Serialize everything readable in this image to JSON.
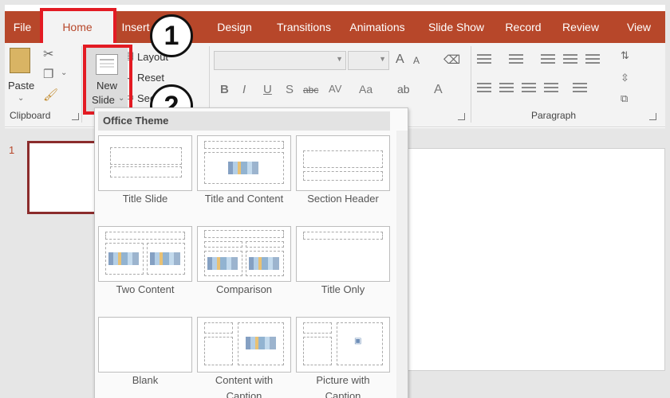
{
  "ribbon_tabs": [
    "File",
    "Home",
    "Insert",
    "Design",
    "Transitions",
    "Animations",
    "Slide Show",
    "Record",
    "Review",
    "View"
  ],
  "active_tab": "Home",
  "clipboard": {
    "paste_label": "Paste",
    "group_label": "Clipboard"
  },
  "slides_group": {
    "new_slide_line1": "New",
    "new_slide_line2": "Slide",
    "layout_label": "Layout",
    "reset_label": "Reset",
    "section_label": "Section"
  },
  "font_group": {
    "bold": "B",
    "italic": "I",
    "underline": "U",
    "strike": "S",
    "spacing": "AV",
    "change_case": "Aa",
    "font_color": "A",
    "grow_font": "A",
    "shrink_font": "A"
  },
  "paragraph": {
    "group_label": "Paragraph"
  },
  "steps": [
    "1",
    "2"
  ],
  "slide_pane": {
    "slide_number": "1"
  },
  "gallery": {
    "header": "Office Theme",
    "layouts": [
      {
        "name_line1": "Title Slide",
        "name_line2": ""
      },
      {
        "name_line1": "Title and Content",
        "name_line2": ""
      },
      {
        "name_line1": "Section Header",
        "name_line2": ""
      },
      {
        "name_line1": "Two Content",
        "name_line2": ""
      },
      {
        "name_line1": "Comparison",
        "name_line2": ""
      },
      {
        "name_line1": "Title Only",
        "name_line2": ""
      },
      {
        "name_line1": "Blank",
        "name_line2": ""
      },
      {
        "name_line1": "Content with",
        "name_line2": "Caption"
      },
      {
        "name_line1": "Picture with",
        "name_line2": "Caption"
      }
    ]
  },
  "colors": {
    "ribbon_accent": "#b7472a",
    "highlight_red": "#e31b23"
  },
  "icons": [
    "paste-icon",
    "cut-icon",
    "copy-icon",
    "format-painter-icon",
    "new-slide-icon",
    "layout-icon",
    "reset-icon",
    "section-icon",
    "dialog-launcher-icon",
    "bullets-icon",
    "numbering-icon",
    "align-left-icon",
    "align-center-icon",
    "align-right-icon",
    "justify-icon"
  ]
}
